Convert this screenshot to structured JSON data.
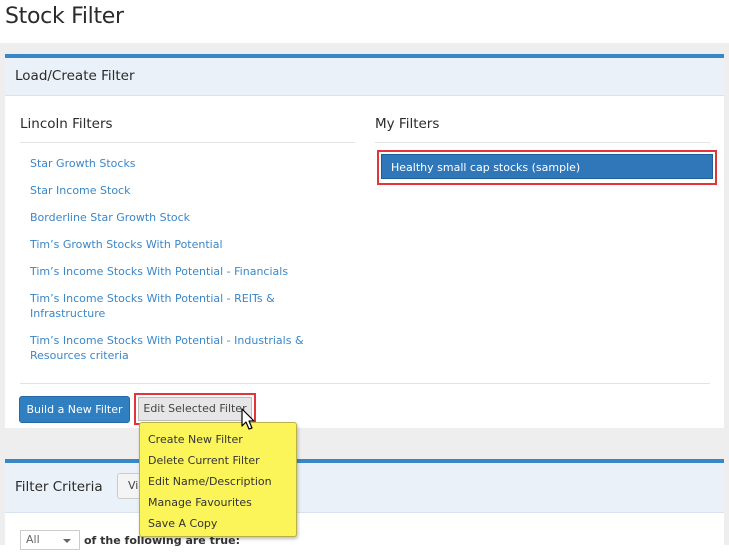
{
  "page_title": "Stock Filter",
  "load_panel": {
    "title": "Load/Create Filter",
    "lincoln": {
      "title": "Lincoln Filters",
      "items": [
        "Star Growth Stocks",
        "Star Income Stock",
        "Borderline Star Growth Stock",
        "Tim’s Growth Stocks With Potential",
        "Tim’s Income Stocks With Potential - Financials",
        "Tim’s Income Stocks With Potential - REITs & Infrastructure",
        "Tim’s Income Stocks With Potential - Industrials & Resources criteria"
      ]
    },
    "my": {
      "title": "My Filters",
      "items": [
        "Healthy small cap stocks (sample)"
      ]
    },
    "build_button": "Build a New Filter",
    "edit_button": "Edit Selected Filter"
  },
  "dropdown_menu": {
    "items": [
      "Create New Filter",
      "Delete Current Filter",
      "Edit Name/Description",
      "Manage Favourites",
      "Save A Copy"
    ]
  },
  "criteria_panel": {
    "title": "Filter Criteria",
    "view_button": "Vi",
    "match_select": "All",
    "following_text": "of the following are true:"
  },
  "colors": {
    "accent": "#3a87c8",
    "selected": "#2f77b8",
    "highlight_border": "#e0353b",
    "menu_bg": "#fbf55a"
  }
}
